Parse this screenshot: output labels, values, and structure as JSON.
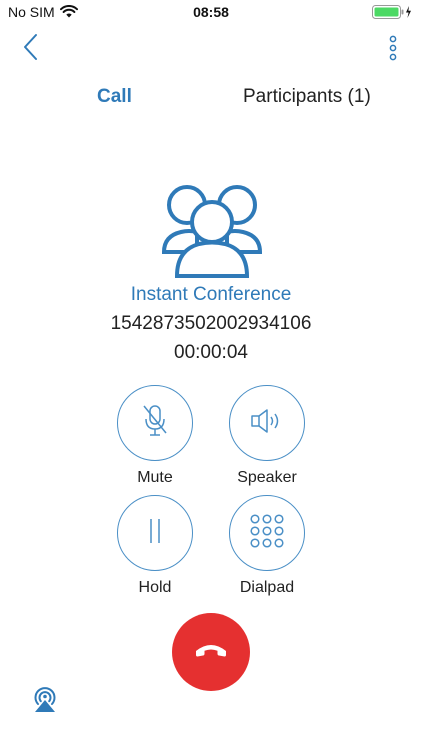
{
  "status_bar": {
    "carrier": "No SIM",
    "time": "08:58",
    "battery_color": "#4cd964"
  },
  "nav": {
    "back_icon": "chevron-left-icon",
    "more_icon": "vertical-ellipsis-icon"
  },
  "tabs": [
    {
      "label": "Call",
      "active": true
    },
    {
      "label": "Participants (1)",
      "active": false
    }
  ],
  "conference": {
    "icon": "group-icon",
    "name": "Instant Conference",
    "number": "1542873502002934106",
    "timer": "00:00:04"
  },
  "controls": {
    "mute": {
      "label": "Mute",
      "icon": "microphone-muted-icon"
    },
    "speaker": {
      "label": "Speaker",
      "icon": "speaker-icon"
    },
    "hold": {
      "label": "Hold",
      "icon": "pause-icon"
    },
    "dialpad": {
      "label": "Dialpad",
      "icon": "dialpad-icon"
    }
  },
  "hangup": {
    "icon": "phone-hangup-icon",
    "color": "#e53030"
  },
  "airplay": {
    "icon": "airplay-icon"
  },
  "colors": {
    "accent": "#2f7ab8",
    "button_outline": "#4a8fc6"
  }
}
